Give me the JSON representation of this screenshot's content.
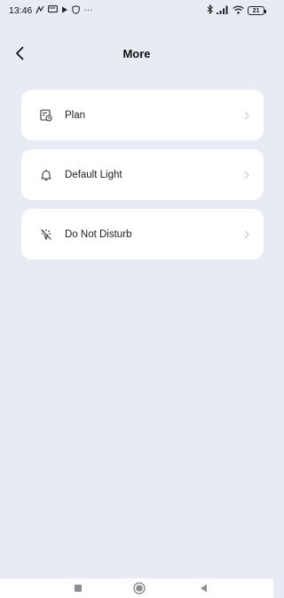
{
  "status_bar": {
    "time": "13:46",
    "more_icons": "···",
    "battery": "21"
  },
  "header": {
    "title": "More"
  },
  "menu": [
    {
      "label": "Plan",
      "icon": "calendar-clock-icon"
    },
    {
      "label": "Default Light",
      "icon": "bell-icon"
    },
    {
      "label": "Do Not Disturb",
      "icon": "light-off-icon"
    }
  ],
  "colors": {
    "background": "#e8ebf4",
    "card": "#ffffff",
    "chevron": "#c8c8cc"
  }
}
